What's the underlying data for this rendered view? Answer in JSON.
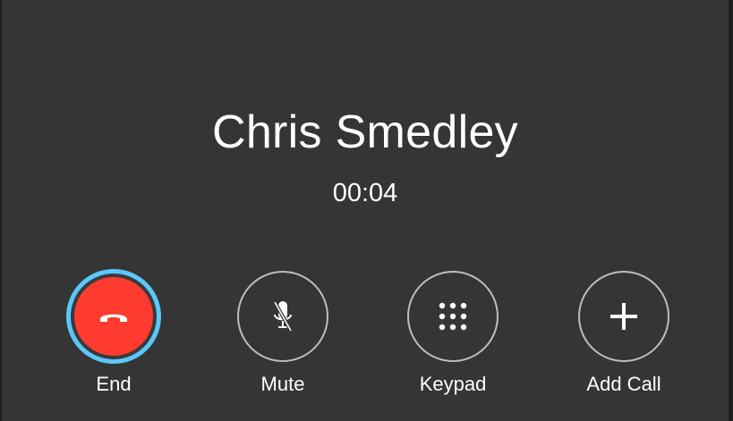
{
  "call": {
    "caller_name": "Chris Smedley",
    "duration": "00:04"
  },
  "actions": [
    {
      "id": "end",
      "label": "End",
      "icon": "phone-hangup-icon"
    },
    {
      "id": "mute",
      "label": "Mute",
      "icon": "microphone-muted-icon"
    },
    {
      "id": "keypad",
      "label": "Keypad",
      "icon": "keypad-dots-icon"
    },
    {
      "id": "add_call",
      "label": "Add Call",
      "icon": "plus-icon"
    }
  ],
  "colors": {
    "background": "#353535",
    "end_button": "#ff3b30",
    "focus_ring": "#5ac8fa",
    "button_outline": "#bdbdbd",
    "text": "#ffffff"
  }
}
